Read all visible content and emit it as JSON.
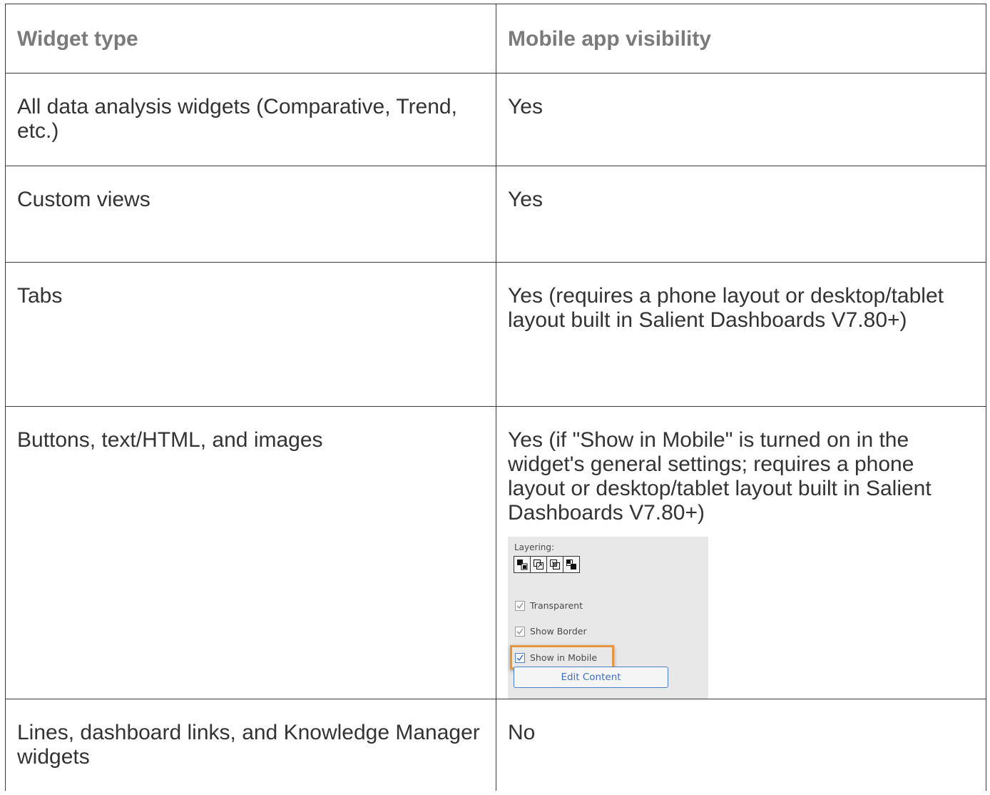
{
  "table": {
    "headers": [
      "Widget type",
      "Mobile app visibility"
    ],
    "rows": [
      {
        "type": "All data analysis widgets (Comparative, Trend, etc.)",
        "visibility": "Yes"
      },
      {
        "type": "Custom views",
        "visibility": "Yes"
      },
      {
        "type": "Tabs",
        "visibility": "Yes (requires a phone layout or desktop/tablet layout built in Salient Dashboards V7.80+)"
      },
      {
        "type": "Buttons, text/HTML, and images",
        "visibility": "Yes (if \"Show in Mobile\" is turned on in the widget's general settings; requires a phone layout or desktop/tablet layout built in Salient Dashboards V7.80+)"
      },
      {
        "type": "Lines, dashboard links, and Knowledge Manager widgets",
        "visibility": "No"
      }
    ]
  },
  "settings_panel": {
    "layering_label": "Layering:",
    "layer_buttons": [
      "bring-to-front-icon",
      "bring-forward-icon",
      "send-backward-icon",
      "send-to-back-icon"
    ],
    "checkboxes": [
      {
        "label": "Transparent",
        "checked": true
      },
      {
        "label": "Show Border",
        "checked": true
      },
      {
        "label": "Show in Mobile",
        "checked": true
      }
    ],
    "edit_button": "Edit Content",
    "highlight_color": "#e8963e"
  }
}
